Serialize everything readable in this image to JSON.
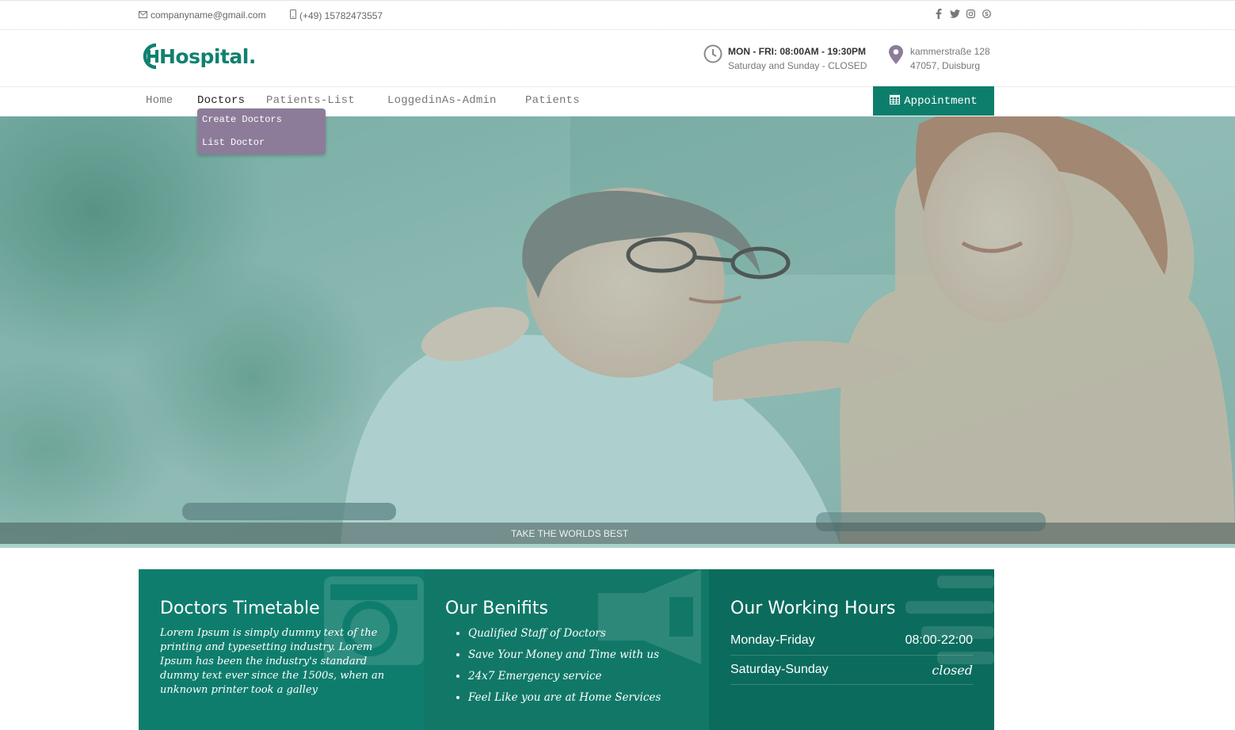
{
  "topbar": {
    "email": "companyname@gmail.com",
    "phone": "(+49) 15782473557",
    "social_icons": [
      "facebook-icon",
      "twitter-icon",
      "instagram-icon",
      "skype-icon"
    ]
  },
  "header": {
    "logo_text": "Hospital.",
    "hours_line1": "MON - FRI: 08:00AM - 19:30PM",
    "hours_line2": "Saturday and Sunday - CLOSED",
    "address_line1": "kammerstraße 128",
    "address_line2": "47057, Duisburg"
  },
  "nav": {
    "items": [
      "Home",
      "Doctors",
      "Patients-List",
      "LoggedinAs-Admin",
      "Patients"
    ],
    "active": "Doctors",
    "appointment_label": "Appointment",
    "dropdown": [
      "Create Doctors",
      "List Doctor"
    ]
  },
  "hero": {
    "caption": "TAKE THE WORLDS BEST"
  },
  "panels": {
    "timetable": {
      "title": "Doctors Timetable",
      "text": "Lorem Ipsum is simply dummy text of the printing and typesetting industry. Lorem Ipsum has been the industry's standard dummy text ever since the 1500s, when an unknown printer took a galley"
    },
    "benefits": {
      "title": "Our Benifits",
      "items": [
        "Qualified Staff of Doctors",
        "Save Your Money and Time with us",
        "24x7 Emergency service",
        "Feel Like you are at Home Services"
      ]
    },
    "hours": {
      "title": "Our Working Hours",
      "rows": [
        {
          "day": "Monday-Friday",
          "time": "08:00-22:00"
        },
        {
          "day": "Saturday-Sunday",
          "time": "closed"
        }
      ]
    }
  },
  "colors": {
    "brand": "#0e7e6c",
    "dropdown": "#8c7c99"
  }
}
